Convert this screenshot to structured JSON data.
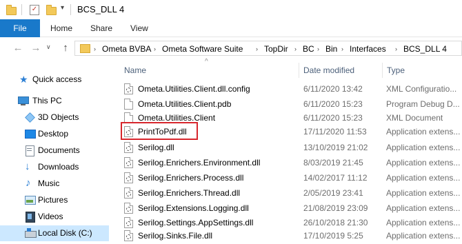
{
  "window": {
    "title": "BCS_DLL 4"
  },
  "ribbon": {
    "tabs": [
      "File",
      "Home",
      "Share",
      "View"
    ]
  },
  "address": {
    "crumbs": [
      "Ometa BVBA",
      "Ometa Software Suite",
      "TopDir",
      "BC",
      "Bin",
      "Interfaces",
      "BCS_DLL 4"
    ]
  },
  "sidebar": {
    "items": [
      {
        "label": "Quick access"
      },
      {
        "label": "This PC"
      },
      {
        "label": "3D Objects"
      },
      {
        "label": "Desktop"
      },
      {
        "label": "Documents"
      },
      {
        "label": "Downloads"
      },
      {
        "label": "Music"
      },
      {
        "label": "Pictures"
      },
      {
        "label": "Videos"
      },
      {
        "label": "Local Disk (C:)"
      }
    ]
  },
  "columns": {
    "name": "Name",
    "date": "Date modified",
    "type": "Type"
  },
  "files": [
    {
      "name": "Ometa.Utilities.Client.dll.config",
      "date": "6/11/2020 13:42",
      "type": "XML Configuratio...",
      "icon": "config-file-icon"
    },
    {
      "name": "Ometa.Utilities.Client.pdb",
      "date": "6/11/2020 15:23",
      "type": "Program Debug D...",
      "icon": "file-icon"
    },
    {
      "name": "Ometa.Utilities.Client",
      "date": "6/11/2020 15:23",
      "type": "XML Document",
      "icon": "file-icon"
    },
    {
      "name": "PrintToPdf.dll",
      "date": "17/11/2020 11:53",
      "type": "Application extens...",
      "icon": "dll-file-icon"
    },
    {
      "name": "Serilog.dll",
      "date": "13/10/2019 21:02",
      "type": "Application extens...",
      "icon": "dll-file-icon"
    },
    {
      "name": "Serilog.Enrichers.Environment.dll",
      "date": "8/03/2019 21:45",
      "type": "Application extens...",
      "icon": "dll-file-icon"
    },
    {
      "name": "Serilog.Enrichers.Process.dll",
      "date": "14/02/2017 11:12",
      "type": "Application extens...",
      "icon": "dll-file-icon"
    },
    {
      "name": "Serilog.Enrichers.Thread.dll",
      "date": "2/05/2019 23:41",
      "type": "Application extens...",
      "icon": "dll-file-icon"
    },
    {
      "name": "Serilog.Extensions.Logging.dll",
      "date": "21/08/2019 23:09",
      "type": "Application extens...",
      "icon": "dll-file-icon"
    },
    {
      "name": "Serilog.Settings.AppSettings.dll",
      "date": "26/10/2018 21:30",
      "type": "Application extens...",
      "icon": "dll-file-icon"
    },
    {
      "name": "Serilog.Sinks.File.dll",
      "date": "17/10/2019 5:25",
      "type": "Application extens...",
      "icon": "dll-file-icon"
    }
  ],
  "colors": {
    "file_tab": "#1979ca",
    "selection": "#cce8ff",
    "highlight": "#d7252c"
  }
}
